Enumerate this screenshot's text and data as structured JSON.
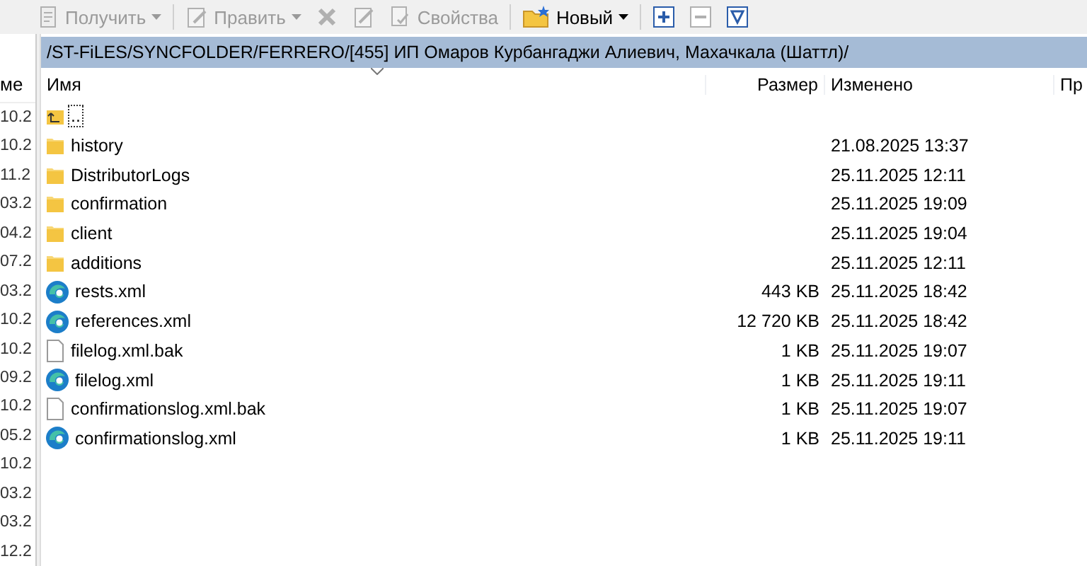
{
  "toolbar": [
    {
      "kind": "menu",
      "label": "Получить",
      "disabled": true
    },
    {
      "kind": "menu",
      "label": "Править",
      "disabled": true
    },
    {
      "kind": "icon",
      "disabled": true
    },
    {
      "kind": "icon",
      "disabled": true
    },
    {
      "kind": "text",
      "label": "Свойства",
      "disabled": true
    },
    {
      "kind": "menu",
      "label": "Новый",
      "disabled": false
    },
    {
      "kind": "icon",
      "disabled": false
    },
    {
      "kind": "icon",
      "disabled": true
    },
    {
      "kind": "icon",
      "disabled": false
    }
  ],
  "left_pane": {
    "column_header": "ме",
    "cells": [
      "10.2",
      "10.2",
      "11.2",
      "03.2",
      "04.2",
      "07.2",
      "03.2",
      "10.2",
      "10.2",
      "09.2",
      "10.2",
      "05.2",
      "10.2",
      "03.2",
      "03.2",
      "12.2"
    ]
  },
  "path": "/ST-FiLES/SYNCFOLDER/FERRERO/[455] ИП Омаров Курбангаджи Алиевич, Махачкала (Шаттл)/",
  "columns": [
    "Имя",
    "Размер",
    "Изменено",
    "Пр"
  ],
  "rows": [
    {
      "kind": "parent",
      "name": "..",
      "size": "",
      "modified": "",
      "selected": true
    },
    {
      "kind": "folder",
      "name": "history",
      "size": "",
      "modified": "21.08.2025 13:37",
      "selected": false
    },
    {
      "kind": "folder",
      "name": "DistributorLogs",
      "size": "",
      "modified": "25.11.2025 12:11",
      "selected": false
    },
    {
      "kind": "folder",
      "name": "confirmation",
      "size": "",
      "modified": "25.11.2025 19:09",
      "selected": false
    },
    {
      "kind": "folder",
      "name": "client",
      "size": "",
      "modified": "25.11.2025 19:04",
      "selected": false
    },
    {
      "kind": "folder",
      "name": "additions",
      "size": "",
      "modified": "25.11.2025 12:11",
      "selected": false
    },
    {
      "kind": "xml",
      "name": "rests.xml",
      "size": "443 KB",
      "modified": "25.11.2025 18:42",
      "selected": false
    },
    {
      "kind": "xml",
      "name": "references.xml",
      "size": "12 720 KB",
      "modified": "25.11.2025 18:42",
      "selected": false
    },
    {
      "kind": "file",
      "name": "filelog.xml.bak",
      "size": "1 KB",
      "modified": "25.11.2025 19:07",
      "selected": false
    },
    {
      "kind": "xml",
      "name": "filelog.xml",
      "size": "1 KB",
      "modified": "25.11.2025 19:11",
      "selected": false
    },
    {
      "kind": "file",
      "name": "confirmationslog.xml.bak",
      "size": "1 KB",
      "modified": "25.11.2025 19:07",
      "selected": false
    },
    {
      "kind": "xml",
      "name": "confirmationslog.xml",
      "size": "1 KB",
      "modified": "25.11.2025 19:11",
      "selected": false
    }
  ]
}
